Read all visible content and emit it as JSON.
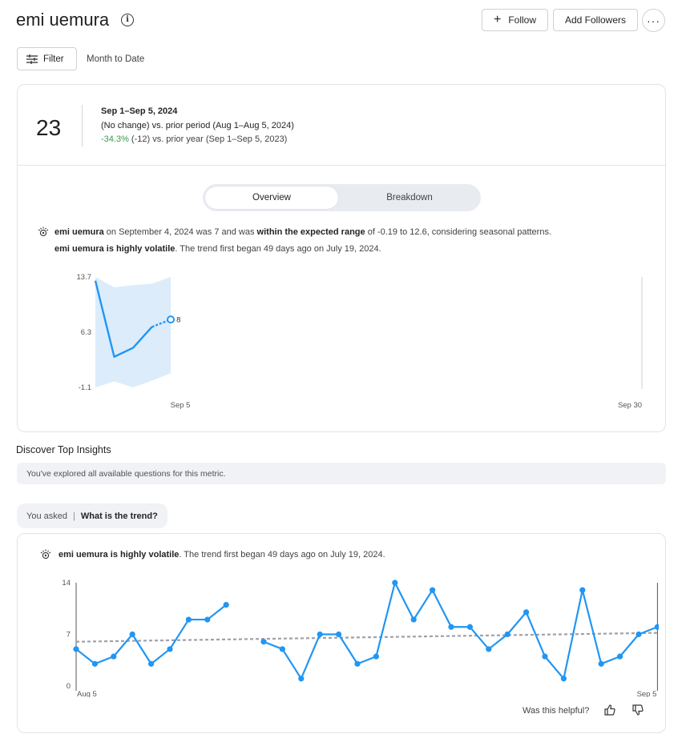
{
  "header": {
    "title": "emi uemura",
    "info_icon": "i",
    "follow_label": "Follow",
    "add_followers_label": "Add Followers",
    "more_label": "···"
  },
  "toolbar": {
    "filter_label": "Filter",
    "date_range": "Month to Date"
  },
  "kpi": {
    "value": "23",
    "period": "Sep 1–Sep 5, 2024",
    "prior_period": "(No change) vs. prior period (Aug 1–Aug 5, 2024)",
    "prior_year_change": "-34.3%",
    "prior_year_rest": " (-12) vs. prior year (Sep 1–Sep 5, 2023)"
  },
  "tabs": {
    "overview": "Overview",
    "breakdown": "Breakdown",
    "active": "overview"
  },
  "insight1": {
    "subject": "emi uemura",
    "text_a": " on September 4, 2024 was 7 and was ",
    "highlight": "within the expected range",
    "text_b": " of -0.19 to 12.6, considering seasonal patterns."
  },
  "insight2": {
    "subject": "emi uemura is highly volatile",
    "text": ". The trend first began 49 days ago on July 19, 2024."
  },
  "chart_data": [
    {
      "type": "line",
      "y_ticks": [
        "13.7",
        "6.3",
        "-1.1"
      ],
      "ylim": [
        -1.1,
        13.7
      ],
      "x_ticks": [
        "Sep 5",
        "Sep 30"
      ],
      "x": [
        1,
        2,
        3,
        4,
        5
      ],
      "values": [
        13.2,
        3,
        4.2,
        7,
        7.1
      ],
      "forecast_point": {
        "x": 5,
        "value": 8,
        "label": "8"
      },
      "expected_range_upper": [
        13.7,
        12.3,
        12.6,
        12.8,
        13.7
      ],
      "expected_range_lower": [
        -1.1,
        -0.3,
        -1.1,
        -0.2,
        0.8
      ],
      "x_domain": [
        1,
        30
      ],
      "series_color": "#2196f3",
      "band_color": "#dcecfb"
    },
    {
      "type": "line",
      "y_ticks": [
        "14",
        "7",
        "0"
      ],
      "ylim": [
        0,
        14
      ],
      "x_ticks": [
        "Aug 5",
        "Sep 5"
      ],
      "segments": [
        [
          5,
          3,
          4,
          7,
          3,
          5,
          9,
          9,
          11
        ],
        [
          6,
          5,
          1,
          7,
          7,
          3,
          4,
          14,
          9,
          13,
          8,
          8,
          5,
          7,
          10,
          4,
          1,
          13,
          3,
          4,
          7,
          8
        ]
      ],
      "trend_start": 6,
      "trend_end": 7.2,
      "series_color": "#2196f3",
      "trend_color": "#a0a0a8"
    }
  ],
  "discover": {
    "title": "Discover Top Insights",
    "message": "You've explored all available questions for this metric."
  },
  "asked": {
    "label": "You asked",
    "question": "What is the trend?"
  },
  "feedback": {
    "prompt": "Was this helpful?"
  },
  "colors": {
    "accent": "#2196f3",
    "positive": "#3a9a4a"
  }
}
